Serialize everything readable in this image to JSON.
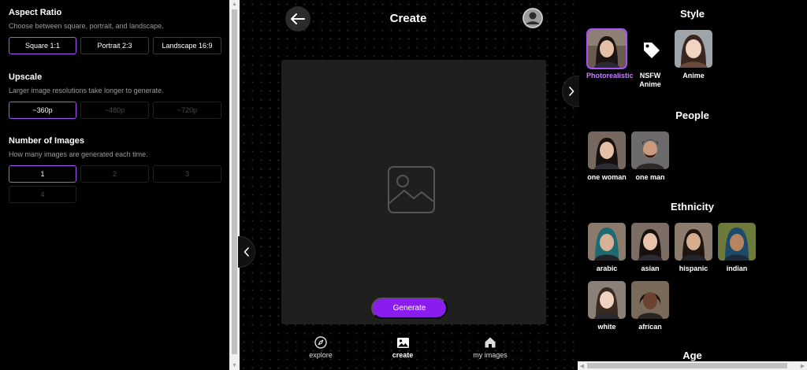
{
  "left": {
    "aspect": {
      "title": "Aspect Ratio",
      "desc": "Choose between square, portrait, and landscape.",
      "options": [
        "Square 1:1",
        "Portrait 2:3",
        "Landscape 16:9"
      ]
    },
    "upscale": {
      "title": "Upscale",
      "desc": "Larger image resolutions take longer to generate.",
      "options": [
        "~360p",
        "~480p",
        "~720p"
      ]
    },
    "count": {
      "title": "Number of Images",
      "desc": "How many images are generated each time.",
      "options": [
        "1",
        "2",
        "3",
        "4"
      ]
    }
  },
  "center": {
    "title": "Create",
    "generate": "Generate",
    "nav": {
      "explore": "explore",
      "create": "create",
      "my_images": "my images"
    }
  },
  "right": {
    "style": {
      "title": "Style",
      "items": [
        "Photorealistic",
        "NSFW Anime",
        "Anime"
      ]
    },
    "people": {
      "title": "People",
      "items": [
        "one woman",
        "one man"
      ]
    },
    "ethnicity": {
      "title": "Ethnicity",
      "items": [
        "arabic",
        "asian",
        "hispanic",
        "indian",
        "white",
        "african"
      ]
    },
    "age": {
      "title": "Age"
    }
  },
  "colors": {
    "accent": "#a855f7",
    "generate": "#8b1cf0"
  }
}
